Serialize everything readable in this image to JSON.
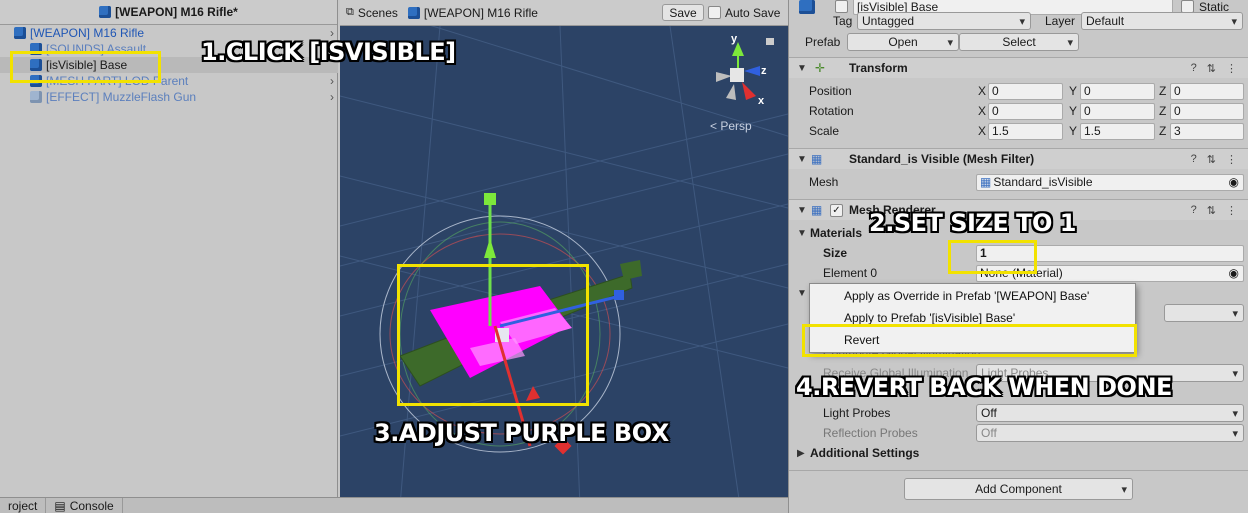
{
  "hierarchy": {
    "title": "[WEAPON] M16 Rifle*",
    "items": [
      {
        "label": "[WEAPON] M16 Rifle"
      },
      {
        "label": "[SOUNDS] Assault"
      },
      {
        "label": "[isVisible] Base"
      },
      {
        "label": "[MESH PART] LOD Parent"
      },
      {
        "label": "[EFFECT] MuzzleFlash Gun"
      }
    ]
  },
  "scene": {
    "tab_scenes": "Scenes",
    "breadcrumb": "[WEAPON] M16 Rifle",
    "save_label": "Save",
    "autosave_label": "Auto Save",
    "persp_label": "< Persp",
    "gizmo_axes": {
      "y": "y",
      "z": "z",
      "x": "x"
    }
  },
  "bottom_tabs": {
    "project": "roject",
    "console": "Console"
  },
  "inspector": {
    "name_field": "[isVisible] Base",
    "static_label": "Static",
    "tag_label": "Tag",
    "tag_value": "Untagged",
    "layer_label": "Layer",
    "layer_value": "Default",
    "prefab_label": "Prefab",
    "prefab_open": "Open",
    "prefab_select": "Select",
    "transform": {
      "title": "Transform",
      "position_label": "Position",
      "rotation_label": "Rotation",
      "scale_label": "Scale",
      "axis_x": "X",
      "axis_y": "Y",
      "axis_z": "Z",
      "position": {
        "x": "0",
        "y": "0",
        "z": "0"
      },
      "rotation": {
        "x": "0",
        "y": "0",
        "z": "0"
      },
      "scale": {
        "x": "1.5",
        "y": "1.5",
        "z": "3"
      }
    },
    "mesh_filter": {
      "title": "Standard_is Visible (Mesh Filter)",
      "mesh_label": "Mesh",
      "mesh_value": "Standard_isVisible"
    },
    "mesh_renderer": {
      "title": "Mesh Renderer",
      "materials_label": "Materials",
      "size_label": "Size",
      "size_value": "1",
      "element0_label": "Element 0",
      "element0_value": "None (Material)",
      "global_illum_label": "Contribute Global Illumination",
      "receive_gi_label": "Receive Global Illumination",
      "receive_gi_value": "Light Probes",
      "light_probes_label": "Light Probes",
      "light_probes_value": "Off",
      "reflection_probes_label": "Reflection Probes",
      "reflection_probes_value": "Off",
      "additional_settings_label": "Additional Settings"
    },
    "add_component_label": "Add Component"
  },
  "context_menu": {
    "items": [
      "Apply as Override in Prefab '[WEAPON] Base'",
      "Apply to Prefab '[isVisible] Base'",
      "Revert"
    ]
  },
  "annotations": {
    "step1": "1.CLICK [ISVISIBLE]",
    "step2": "2.SET SIZE TO 1",
    "step3": "3.ADJUST PURPLE BOX",
    "step4": "4.REVERT BACK WHEN DONE"
  },
  "colors": {
    "highlight": "#f2e200",
    "object_magenta": "#ff00ff",
    "scene_bg": "#2c4366"
  }
}
